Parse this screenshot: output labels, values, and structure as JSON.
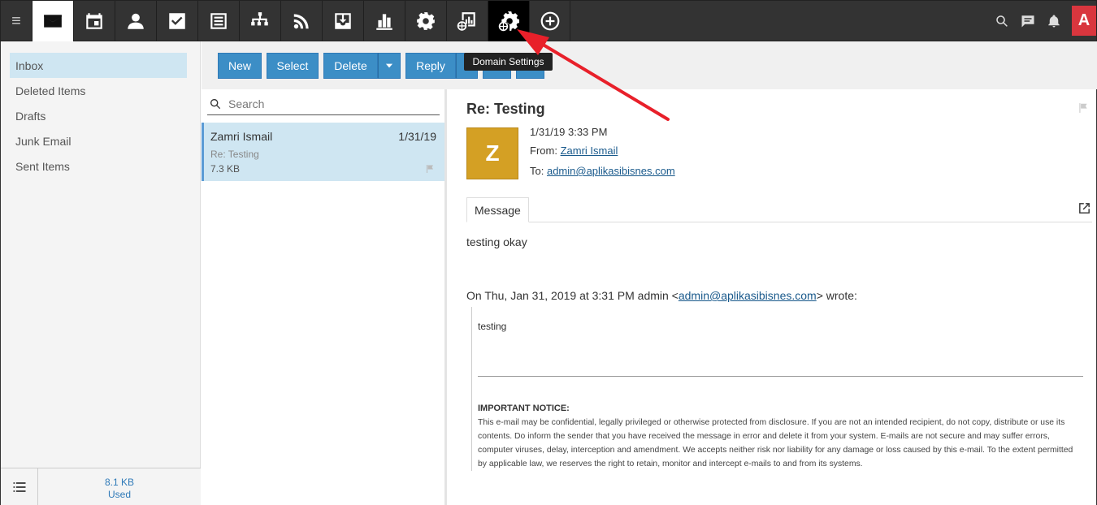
{
  "topbar": {
    "apps": [
      {
        "icon": "mail-icon",
        "name": "mail"
      },
      {
        "icon": "calendar-icon",
        "name": "calendar"
      },
      {
        "icon": "contacts-icon",
        "name": "contacts"
      },
      {
        "icon": "tasks-icon",
        "name": "tasks"
      },
      {
        "icon": "notes-icon",
        "name": "notes"
      },
      {
        "icon": "sitemap-icon",
        "name": "sitemap"
      },
      {
        "icon": "rss-icon",
        "name": "rss"
      },
      {
        "icon": "inbox-download-icon",
        "name": "download"
      },
      {
        "icon": "bar-chart-icon",
        "name": "reports"
      },
      {
        "icon": "gear-icon",
        "name": "settings"
      },
      {
        "icon": "domain-reports-icon",
        "name": "domain-reports"
      },
      {
        "icon": "domain-settings-icon",
        "name": "domain-settings"
      },
      {
        "icon": "add-circle-icon",
        "name": "add"
      }
    ],
    "user_initial": "A"
  },
  "folders": [
    {
      "label": "Inbox",
      "active": true
    },
    {
      "label": "Deleted Items",
      "active": false
    },
    {
      "label": "Drafts",
      "active": false
    },
    {
      "label": "Junk Email",
      "active": false
    },
    {
      "label": "Sent Items",
      "active": false
    }
  ],
  "storage": {
    "size": "8.1 KB",
    "label": "Used"
  },
  "toolbar": {
    "new_label": "New",
    "select_label": "Select",
    "delete_label": "Delete",
    "reply_label": "Reply"
  },
  "tooltip": "Domain Settings",
  "search": {
    "placeholder": "Search"
  },
  "messages": [
    {
      "sender": "Zamri Ismail",
      "date": "1/31/19",
      "subject": "Re: Testing",
      "size": "7.3 KB"
    }
  ],
  "reading": {
    "subject": "Re: Testing",
    "avatar_initial": "Z",
    "datetime": "1/31/19 3:33 PM",
    "from_label": "From:",
    "from": "Zamri Ismail",
    "to_label": "To:",
    "to": "admin@aplikasibisnes.com",
    "tab_label": "Message",
    "body": "testing okay",
    "quote_prefix": "On Thu, Jan 31, 2019 at 3:31 PM admin <",
    "quote_email": "admin@aplikasibisnes.com",
    "quote_suffix": "> wrote:",
    "quoted_text": "testing",
    "notice_title": "IMPORTANT NOTICE:",
    "notice_body": "This e-mail may be confidential, legally privileged or otherwise protected from disclosure. If you are not an intended recipient, do not copy, distribute or use its contents. Do inform the sender that you have received the message in error and delete it from your system. E-mails are not secure and may suffer errors, computer viruses, delay, interception and amendment. We accepts neither risk nor liability for any damage or loss caused by this e-mail. To the extent permitted by applicable law, we reserves the right to retain, monitor and intercept e-mails to and from its systems."
  },
  "colors": {
    "accent": "#3c8ec6",
    "topbar": "#333333",
    "selected_row": "#cfe6f2",
    "avatar": "#d4a024",
    "annotation": "#e8202a"
  }
}
